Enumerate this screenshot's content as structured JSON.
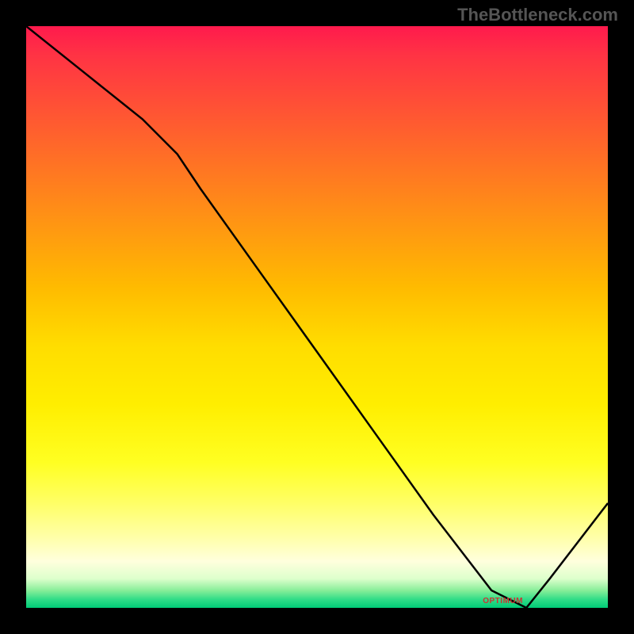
{
  "watermark": "TheBottleneck.com",
  "optimum_label": "OPTIMUM",
  "chart_data": {
    "type": "line",
    "title": "",
    "xlabel": "",
    "ylabel": "",
    "x": [
      0,
      10,
      20,
      26,
      30,
      40,
      50,
      60,
      70,
      80,
      86,
      90,
      100
    ],
    "values": [
      100,
      92,
      84,
      78,
      72,
      58,
      44,
      30,
      16,
      3,
      0,
      5,
      18
    ],
    "xlim": [
      0,
      100
    ],
    "ylim": [
      0,
      100
    ],
    "optimum_x": 86,
    "background_gradient": {
      "top": "#ff1a4d",
      "mid": "#ffee00",
      "bottom": "#00cc77"
    }
  }
}
